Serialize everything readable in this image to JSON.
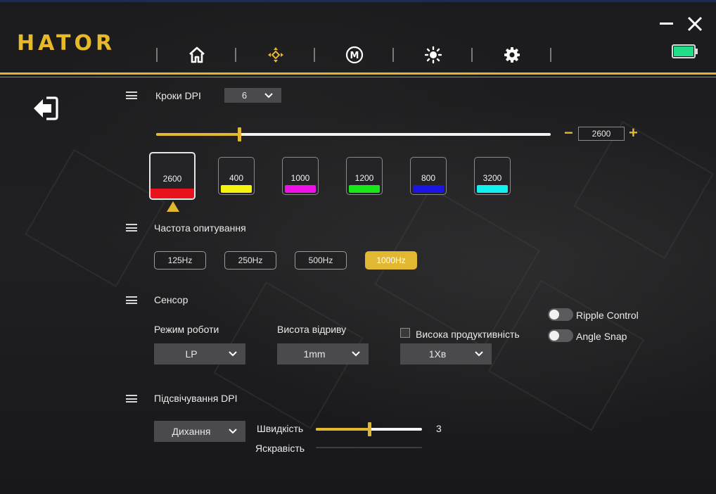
{
  "app": {
    "logo": "HATOR"
  },
  "nav": {
    "items": [
      {
        "name": "home-icon"
      },
      {
        "name": "dpi-target-icon",
        "active": true
      },
      {
        "name": "macro-icon",
        "glyph": "M"
      },
      {
        "name": "brightness-icon"
      },
      {
        "name": "gear-icon"
      }
    ]
  },
  "battery": {
    "color": "#22dd88"
  },
  "dpi": {
    "title": "Кроки DPI",
    "steps_value": "6",
    "current_value": "2600",
    "slider_fraction": 0.21,
    "minus": "−",
    "plus": "+",
    "levels": [
      {
        "value": "2600",
        "color": "#e8121c",
        "active": true
      },
      {
        "value": "400",
        "color": "#f4f20e"
      },
      {
        "value": "1000",
        "color": "#ef12e6"
      },
      {
        "value": "1200",
        "color": "#18e81a"
      },
      {
        "value": "800",
        "color": "#1d14e6"
      },
      {
        "value": "3200",
        "color": "#12f0f0"
      }
    ]
  },
  "polling": {
    "title": "Частота опитування",
    "rates": [
      "125Hz",
      "250Hz",
      "500Hz",
      "1000Hz"
    ],
    "selected": "1000Hz"
  },
  "sensor": {
    "title": "Сенсор",
    "mode_label": "Режим роботи",
    "mode_value": "LP",
    "lod_label": "Висота відриву",
    "lod_value": "1mm",
    "hp_label": "Висока продуктивність",
    "hp_checked": false,
    "hp_value": "1Хв",
    "ripple_label": "Ripple Control",
    "ripple_on": false,
    "angle_label": "Angle Snap",
    "angle_on": false
  },
  "lighting": {
    "title": "Підсвічування DPI",
    "effect_value": "Дихання",
    "speed_label": "Швидкість",
    "speed_value": "3",
    "speed_fraction": 0.5,
    "brightness_label": "Яскравість",
    "brightness_fraction": 0.0
  },
  "colors": {
    "accent": "#e2b731"
  }
}
